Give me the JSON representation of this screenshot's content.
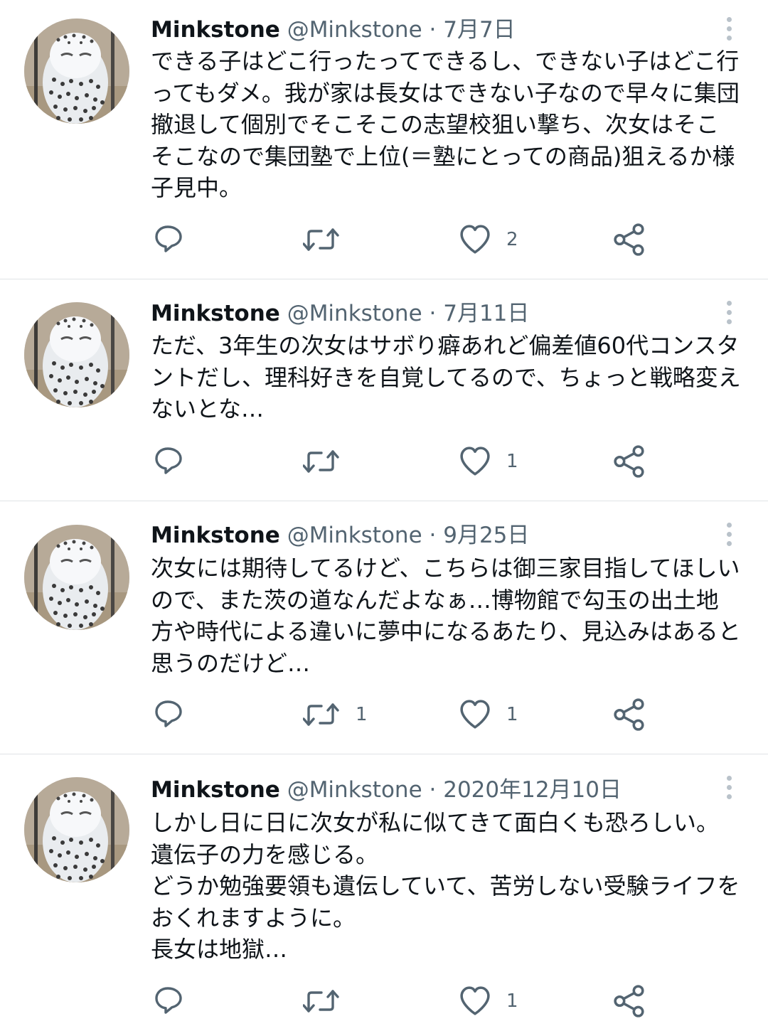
{
  "tweets": [
    {
      "name": "Minkstone",
      "handle": "@Minkstone",
      "separator": "·",
      "date": "7月7日",
      "text": "できる子はどこ行ったってできるし、できない子はどこ行ってもダメ。我が家は長女はできない子なので早々に集団撤退して個別でそこそこの志望校狙い撃ち、次女はそこそこなので集団塾で上位(＝塾にとっての商品)狙えるか様子見中。",
      "retweets": "",
      "likes": "2"
    },
    {
      "name": "Minkstone",
      "handle": "@Minkstone",
      "separator": "·",
      "date": "7月11日",
      "text": "ただ、3年生の次女はサボり癖あれど偏差値60代コンスタントだし、理科好きを自覚してるので、ちょっと戦略変えないとな…",
      "retweets": "",
      "likes": "1"
    },
    {
      "name": "Minkstone",
      "handle": "@Minkstone",
      "separator": "·",
      "date": "9月25日",
      "text": "次女には期待してるけど、こちらは御三家目指してほしいので、また茨の道なんだよなぁ…博物館で勾玉の出土地方や時代による違いに夢中になるあたり、見込みはあると思うのだけど…",
      "retweets": "1",
      "likes": "1"
    },
    {
      "name": "Minkstone",
      "handle": "@Minkstone",
      "separator": "·",
      "date": "2020年12月10日",
      "text": "しかし日に日に次女が私に似てきて面白くも恐ろしい。\n遺伝子の力を感じる。\nどうか勉強要領も遺伝していて、苦労しない受験ライフをおくれますように。\n長女は地獄…",
      "retweets": "",
      "likes": "1"
    }
  ],
  "icons": {
    "reply": "reply-icon",
    "retweet": "retweet-icon",
    "like": "heart-icon",
    "share": "share-icon",
    "more": "more-options-icon"
  },
  "colors": {
    "text": "#0f1419",
    "secondary": "#536471",
    "divider": "#dfe3e6"
  }
}
